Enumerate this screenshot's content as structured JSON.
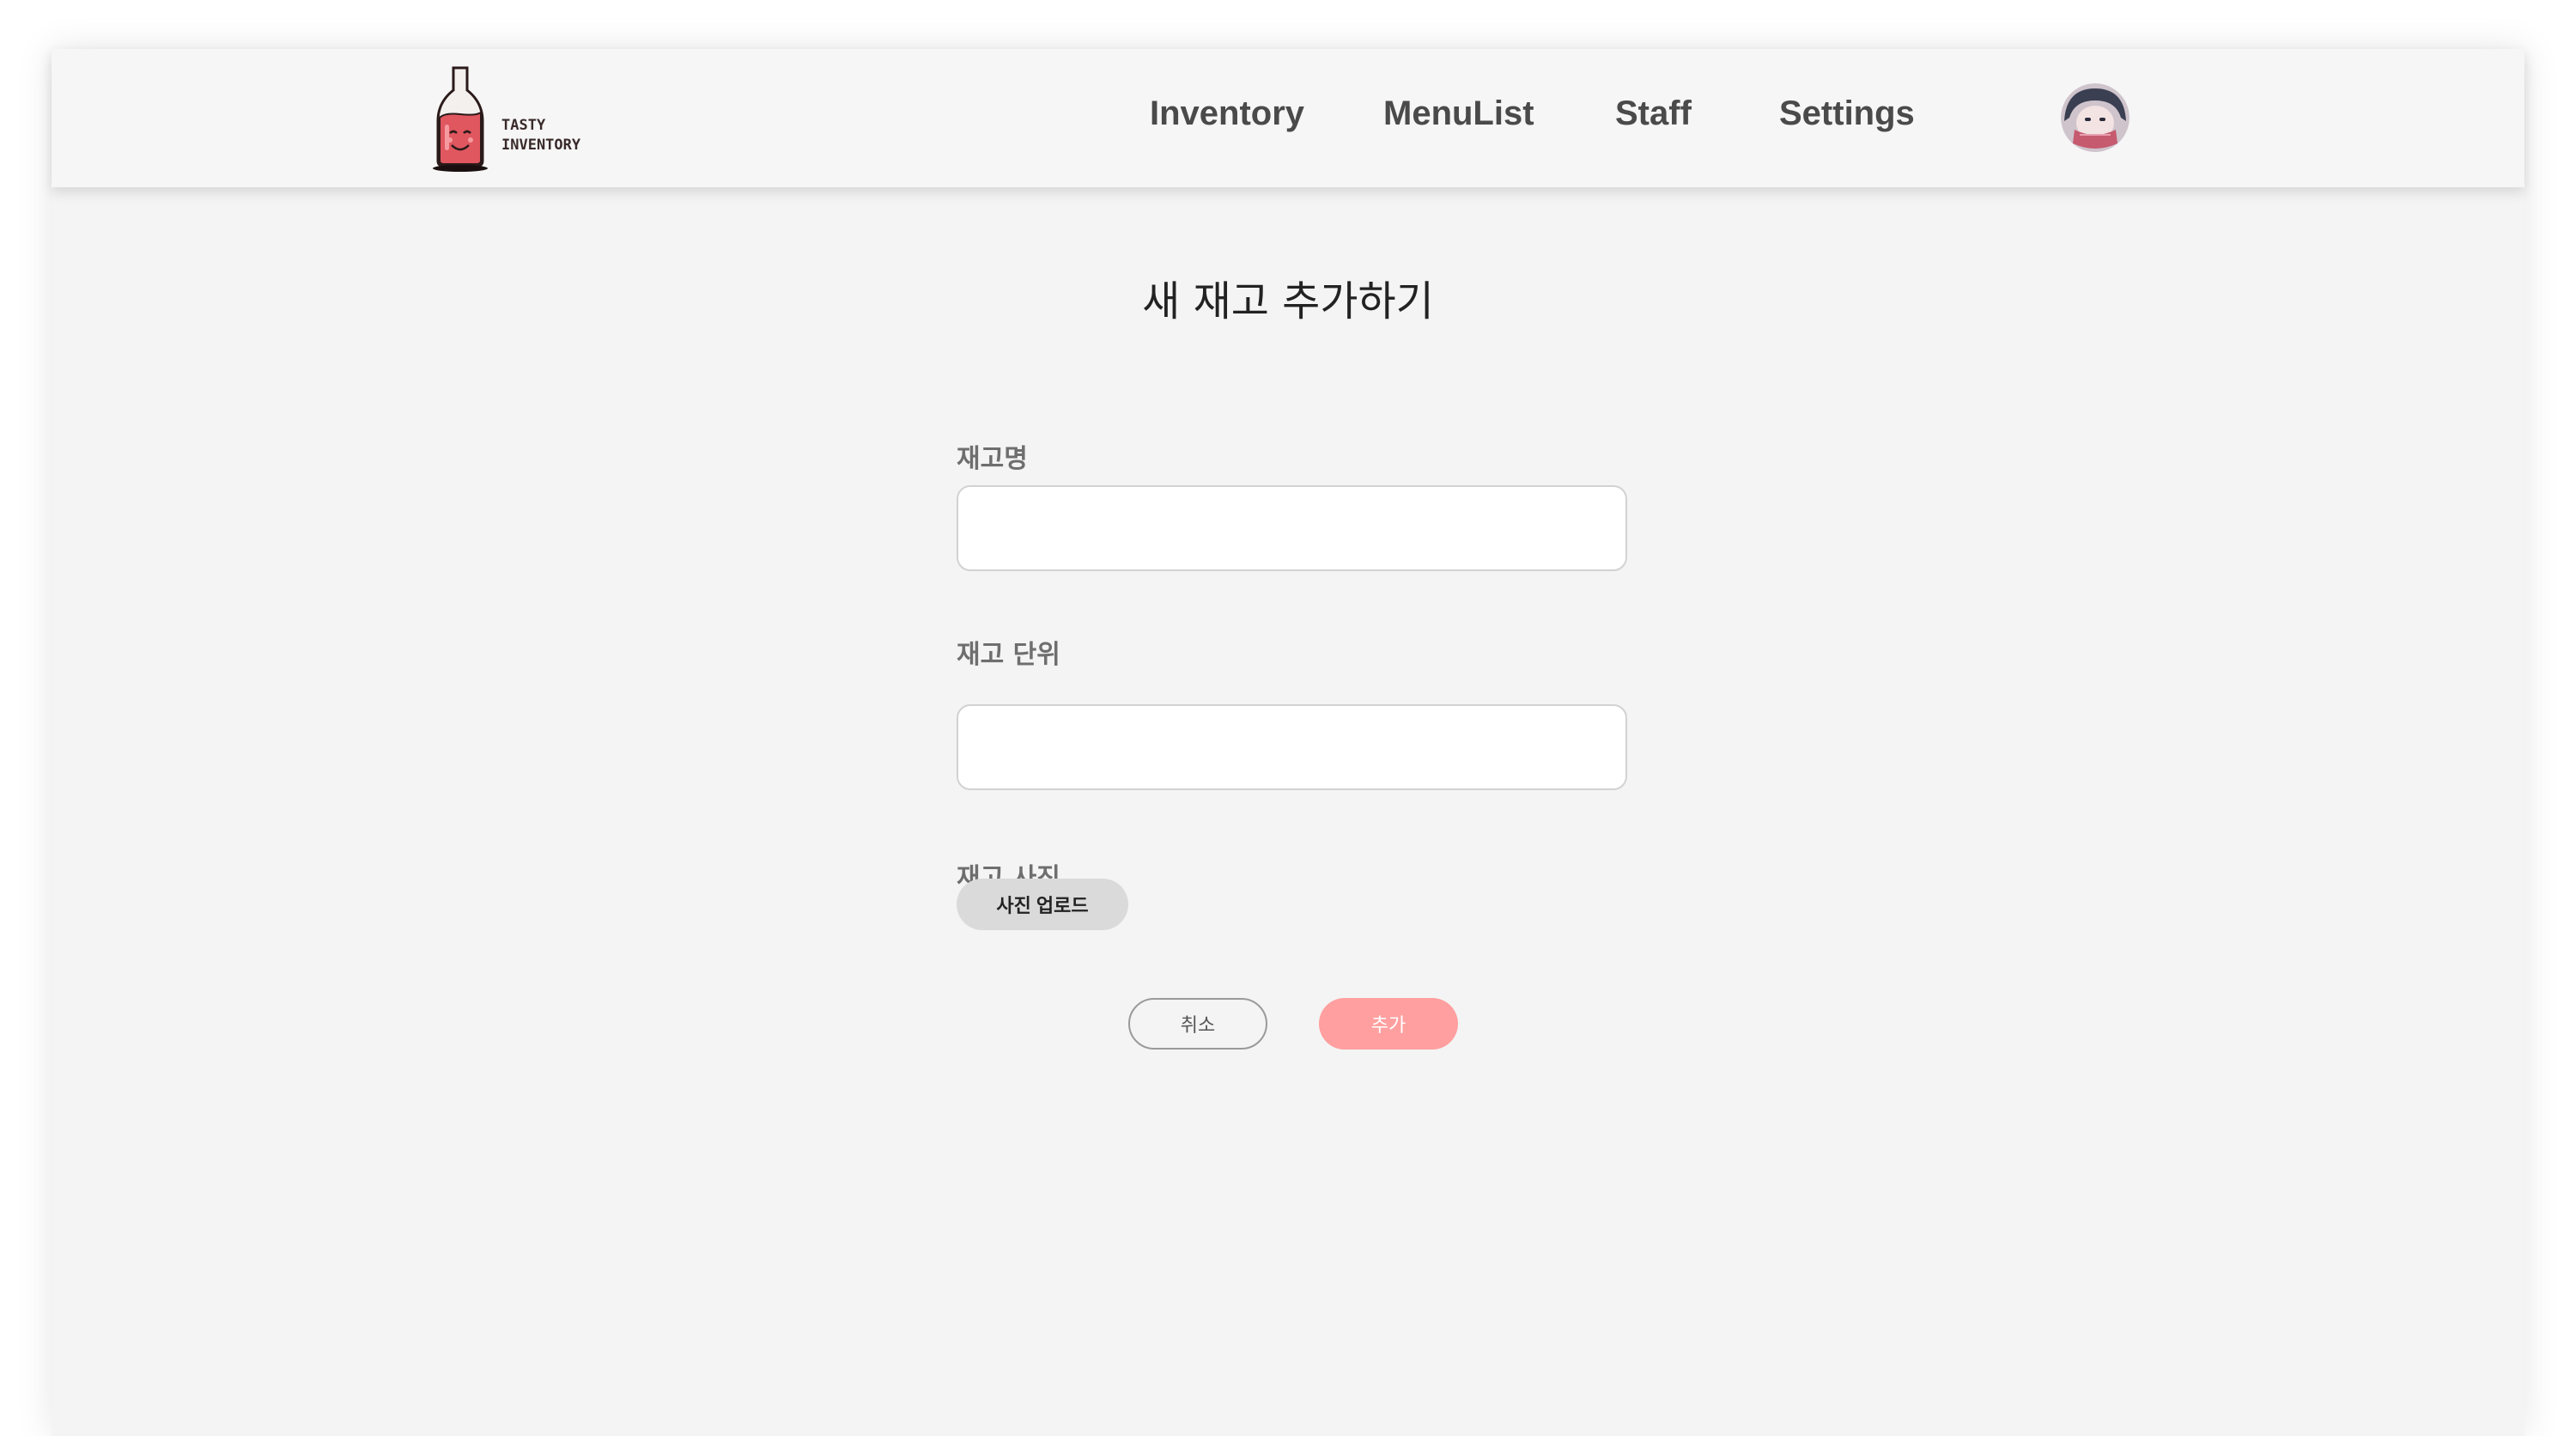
{
  "header": {
    "logo_line1": "TASTY",
    "logo_line2": "INVENTORY",
    "nav": [
      {
        "label": "Inventory"
      },
      {
        "label": "MenuList"
      },
      {
        "label": "Staff"
      },
      {
        "label": "Settings"
      }
    ],
    "avatar_icon": "user-avatar"
  },
  "form": {
    "title": "새 재고 추가하기",
    "name_label": "재고명",
    "name_value": "",
    "unit_label": "재고 단위",
    "unit_value": "",
    "photo_label": "재고 사진",
    "upload_label": "사진 업로드",
    "cancel_label": "취소",
    "add_label": "추가"
  },
  "colors": {
    "accent": "#ff9f9f",
    "bottle": "#e0575f",
    "background": "#f4f4f4",
    "header_bg": "#f6f6f6"
  }
}
